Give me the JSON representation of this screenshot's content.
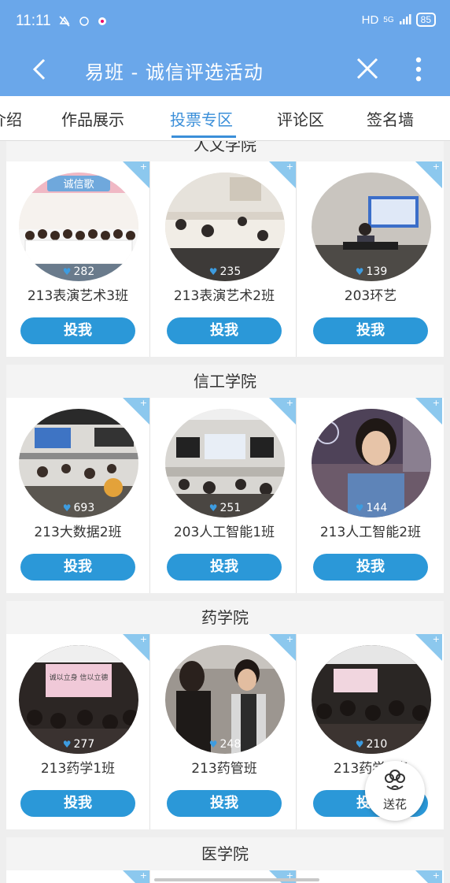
{
  "status_bar": {
    "time": "11:11",
    "left_icons": [
      "mute-icon",
      "app-icon",
      "app-icon"
    ],
    "hd": "HD",
    "network": "5G",
    "battery": "85"
  },
  "header": {
    "title": "易班 - 诚信评选活动",
    "background": "#6aa7ea"
  },
  "tabs": [
    {
      "label": "介绍",
      "active": false
    },
    {
      "label": "作品展示",
      "active": false
    },
    {
      "label": "投票专区",
      "active": true
    },
    {
      "label": "评论区",
      "active": false
    },
    {
      "label": "签名墙",
      "active": false
    }
  ],
  "accent_color": "#2b98d8",
  "sections": [
    {
      "name": "人文学院",
      "entries": [
        {
          "votes": "282",
          "name": "213表演艺术3班",
          "button": "投我"
        },
        {
          "votes": "235",
          "name": "213表演艺术2班",
          "button": "投我"
        },
        {
          "votes": "139",
          "name": "203环艺",
          "button": "投我"
        }
      ]
    },
    {
      "name": "信工学院",
      "entries": [
        {
          "votes": "693",
          "name": "213大数据2班",
          "button": "投我"
        },
        {
          "votes": "251",
          "name": "203人工智能1班",
          "button": "投我"
        },
        {
          "votes": "144",
          "name": "213人工智能2班",
          "button": "投我"
        }
      ]
    },
    {
      "name": "药学院",
      "entries": [
        {
          "votes": "277",
          "name": "213药学1班",
          "button": "投我"
        },
        {
          "votes": "248",
          "name": "213药管班",
          "button": "投我"
        },
        {
          "votes": "210",
          "name": "213药学4班",
          "button": "投我"
        }
      ]
    },
    {
      "name": "医学院",
      "entries": []
    }
  ],
  "flower_button": {
    "label": "送花"
  },
  "photo_text": {
    "banner_1": "诚信歌",
    "slide_7": "诚以立身 信以立德"
  }
}
